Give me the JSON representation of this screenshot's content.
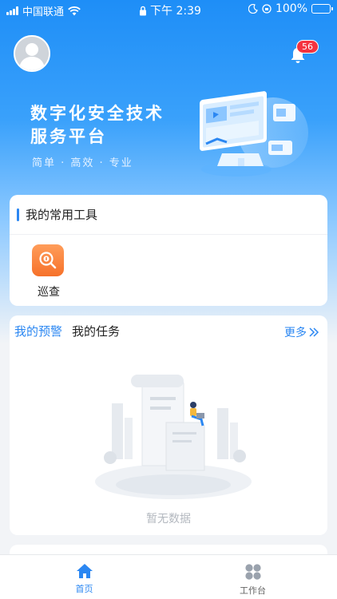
{
  "status_bar": {
    "carrier": "中国联通",
    "time": "下午 2:39",
    "battery": "100%"
  },
  "header": {
    "notification_count": "56"
  },
  "banner": {
    "title_line1": "数字化安全技术",
    "title_line2": "服务平台",
    "subtitle": "简单 · 高效 · 专业"
  },
  "tools": {
    "title": "我的常用工具",
    "items": [
      {
        "label": "巡查",
        "icon": "search-money-icon"
      }
    ]
  },
  "tasks": {
    "tabs": [
      "我的预警",
      "我的任务"
    ],
    "active_tab": 0,
    "more_label": "更多",
    "empty_text": "暂无数据"
  },
  "tabbar": {
    "items": [
      {
        "label": "首页",
        "icon": "home-icon",
        "active": true
      },
      {
        "label": "工作台",
        "icon": "grid-icon",
        "active": false
      }
    ]
  },
  "colors": {
    "primary": "#2b87f2",
    "badge": "#f5333f",
    "tool_orange": "#f6712a"
  }
}
